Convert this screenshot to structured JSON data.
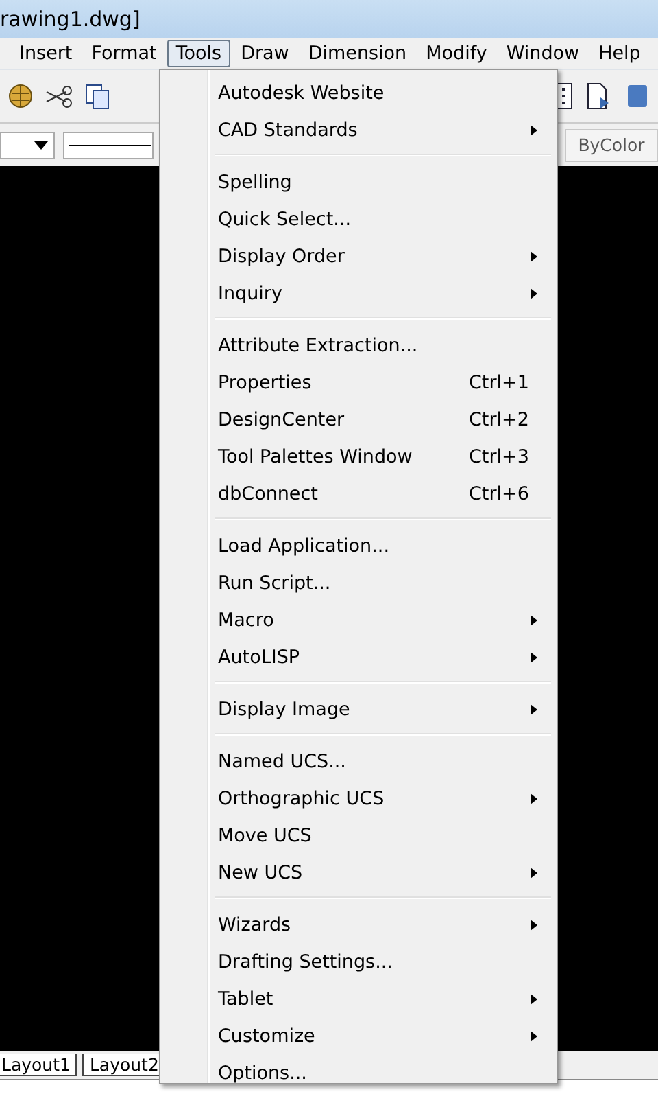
{
  "window": {
    "title": "rawing1.dwg]"
  },
  "menubar": [
    {
      "label": "Insert",
      "selected": false
    },
    {
      "label": "Format",
      "selected": false
    },
    {
      "label": "Tools",
      "selected": true
    },
    {
      "label": "Draw",
      "selected": false
    },
    {
      "label": "Dimension",
      "selected": false
    },
    {
      "label": "Modify",
      "selected": false
    },
    {
      "label": "Window",
      "selected": false
    },
    {
      "label": "Help",
      "selected": false
    }
  ],
  "properties_bar": {
    "color_control": "ByColor"
  },
  "menu": [
    [
      {
        "label": "Autodesk Website",
        "submenu": false
      },
      {
        "label": "CAD Standards",
        "submenu": true
      }
    ],
    [
      {
        "label": "Spelling",
        "submenu": false
      },
      {
        "label": "Quick Select...",
        "submenu": false
      },
      {
        "label": "Display Order",
        "submenu": true
      },
      {
        "label": "Inquiry",
        "submenu": true
      }
    ],
    [
      {
        "label": "Attribute Extraction...",
        "submenu": false
      },
      {
        "label": "Properties",
        "shortcut": "Ctrl+1",
        "submenu": false
      },
      {
        "label": "DesignCenter",
        "shortcut": "Ctrl+2",
        "submenu": false
      },
      {
        "label": "Tool Palettes Window",
        "shortcut": "Ctrl+3",
        "submenu": false
      },
      {
        "label": "dbConnect",
        "shortcut": "Ctrl+6",
        "submenu": false
      }
    ],
    [
      {
        "label": "Load Application...",
        "submenu": false
      },
      {
        "label": "Run Script...",
        "submenu": false
      },
      {
        "label": "Macro",
        "submenu": true
      },
      {
        "label": "AutoLISP",
        "submenu": true
      }
    ],
    [
      {
        "label": "Display Image",
        "submenu": true
      }
    ],
    [
      {
        "label": "Named UCS...",
        "submenu": false
      },
      {
        "label": "Orthographic UCS",
        "submenu": true
      },
      {
        "label": "Move UCS",
        "submenu": false
      },
      {
        "label": "New UCS",
        "submenu": true
      }
    ],
    [
      {
        "label": "Wizards",
        "submenu": true
      },
      {
        "label": "Drafting Settings...",
        "submenu": false
      },
      {
        "label": "Tablet",
        "submenu": true
      },
      {
        "label": "Customize",
        "submenu": true
      },
      {
        "label": "Options...",
        "submenu": false
      }
    ]
  ],
  "layout_tabs": [
    {
      "label": "Layout1"
    },
    {
      "label": "Layout2"
    }
  ]
}
